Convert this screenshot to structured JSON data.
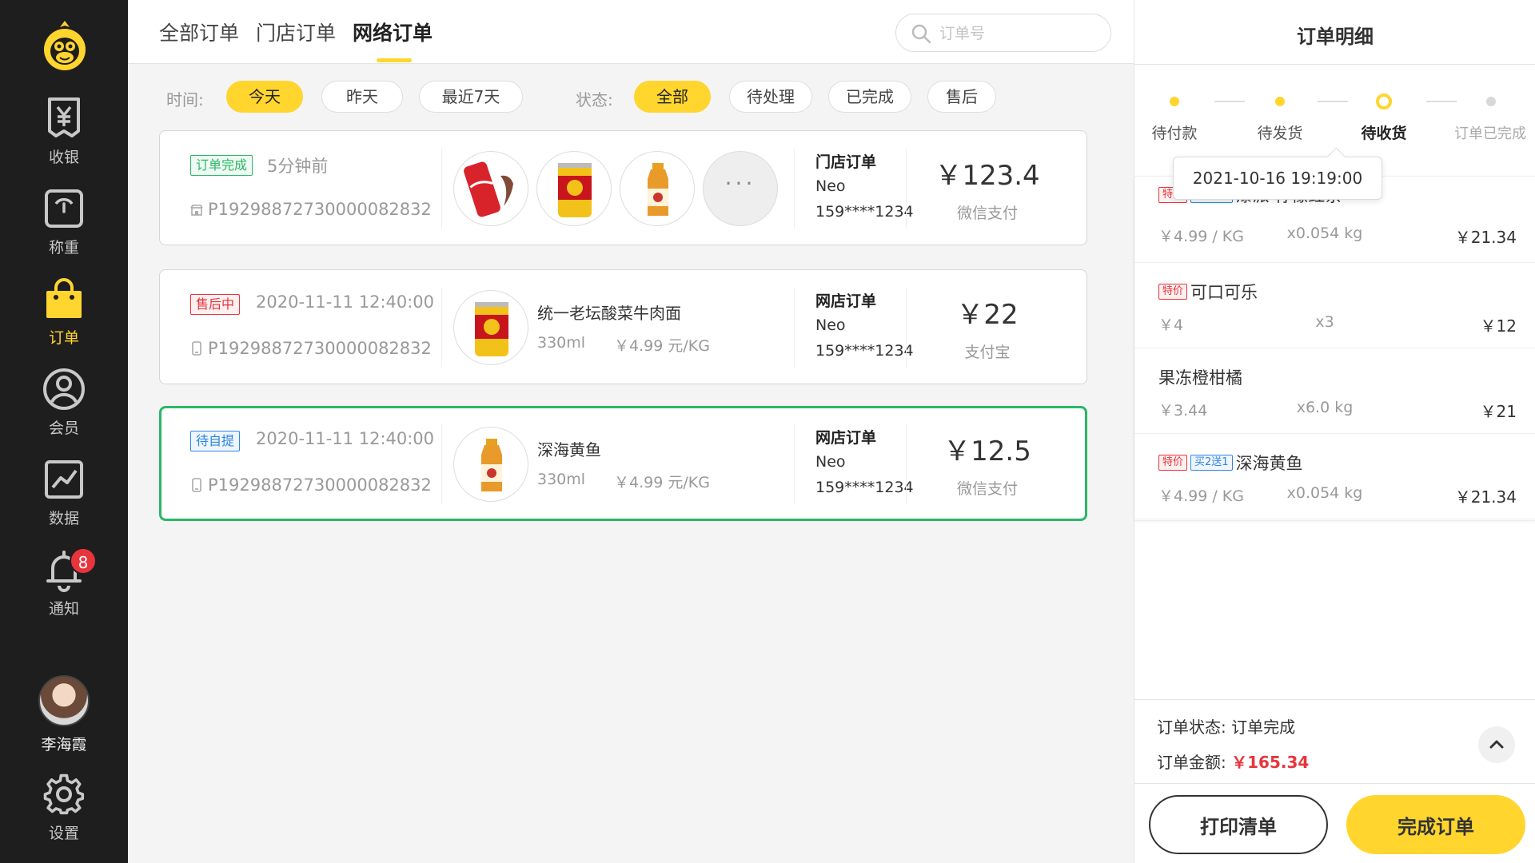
{
  "sidebar": {
    "items": [
      {
        "label": "收银"
      },
      {
        "label": "称重"
      },
      {
        "label": "订单"
      },
      {
        "label": "会员"
      },
      {
        "label": "数据"
      },
      {
        "label": "通知",
        "badge": "8"
      }
    ],
    "user_name": "李海霞",
    "settings_label": "设置"
  },
  "header": {
    "tabs": [
      {
        "label": "全部订单"
      },
      {
        "label": "门店订单"
      },
      {
        "label": "网络订单"
      }
    ],
    "search_placeholder": "订单号"
  },
  "filters": {
    "time_label": "时间:",
    "time_options": [
      "今天",
      "昨天",
      "最近7天"
    ],
    "status_label": "状态:",
    "status_options": [
      "全部",
      "待处理",
      "已完成",
      "售后"
    ]
  },
  "orders": [
    {
      "tag": "订单完成",
      "time": "5分钟前",
      "id": "P19298872730000082832",
      "order_type": "门店订单",
      "customer": "Neo",
      "phone": "159****1234",
      "amount": "￥123.4",
      "payment": "微信支付"
    },
    {
      "tag": "售后中",
      "time": "2020-11-11 12:40:00",
      "id": "P19298872730000082832",
      "product": "统一老坛酸菜牛肉面",
      "spec": "330ml",
      "unit_price": "￥4.99 元/KG",
      "order_type": "网店订单",
      "customer": "Neo",
      "phone": "159****1234",
      "amount": "￥22",
      "payment": "支付宝"
    },
    {
      "tag": "待自提",
      "time": "2020-11-11 12:40:00",
      "id": "P19298872730000082832",
      "product": "深海黄鱼",
      "spec": "330ml",
      "unit_price": "￥4.99 元/KG",
      "order_type": "网店订单",
      "customer": "Neo",
      "phone": "159****1234",
      "amount": "￥12.5",
      "payment": "微信支付"
    }
  ],
  "detail": {
    "title": "订单明细",
    "steps": [
      {
        "label": "待付款"
      },
      {
        "label": "待发货"
      },
      {
        "label": "待收货"
      },
      {
        "label": "订单已完成"
      }
    ],
    "tooltip": "2021-10-16   19:19:00",
    "items": [
      {
        "tag1": "特价",
        "tag2": "买2送1",
        "name": "漆派 柠檬红茶",
        "unit": "￥4.99 / KG",
        "qty": "x0.054 kg",
        "total": "￥21.34"
      },
      {
        "tag1": "特价",
        "name": "可口可乐",
        "unit": "￥4",
        "qty": "x3",
        "total": "￥12"
      },
      {
        "name": "果冻橙柑橘",
        "unit": "￥3.44",
        "qty": "x6.0 kg",
        "total": "￥21"
      },
      {
        "tag1": "特价",
        "tag2": "买2送1",
        "name": "深海黄鱼",
        "unit": "￥4.99 / KG",
        "qty": "x0.054 kg",
        "total": "￥21.34"
      }
    ],
    "status_label": "订单状态:",
    "status_value": "订单完成",
    "amount_label": "订单金额:",
    "amount_value": "￥165.34",
    "print_label": "打印清单",
    "complete_label": "完成订单"
  },
  "colors": {
    "accent": "#ffd52e",
    "sidebar_bg": "#1e1e1e",
    "selected_border": "#29b865",
    "price_red": "#e8343c"
  },
  "icons": [
    "monkey-logo",
    "yen-receipt-icon",
    "scale-icon",
    "shopping-bag-icon",
    "user-circle-icon",
    "line-chart-icon",
    "bell-icon",
    "gear-icon",
    "search-icon",
    "store-icon",
    "phone-icon",
    "chevron-up-icon"
  ]
}
